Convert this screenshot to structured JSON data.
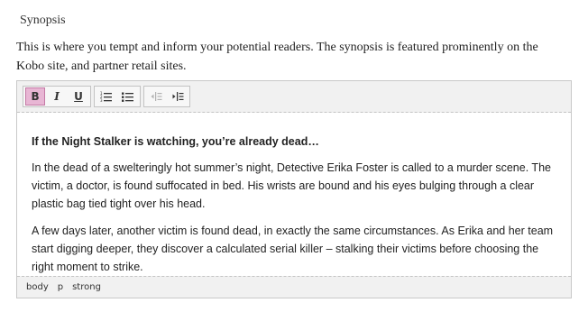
{
  "section": {
    "label": "Synopsis",
    "intro": "This is where you tempt and inform your potential readers. The synopsis is featured prominently on the Kobo site, and partner retail sites."
  },
  "toolbar": {
    "bold_label": "B",
    "italic_label": "I",
    "underline_label": "U",
    "buttons": [
      {
        "name": "bold",
        "icon": "bold-icon",
        "active": true
      },
      {
        "name": "italic",
        "icon": "italic-icon",
        "active": false
      },
      {
        "name": "underline",
        "icon": "underline-icon",
        "active": false
      },
      {
        "name": "numbered-list",
        "icon": "numbered-list-icon"
      },
      {
        "name": "bullet-list",
        "icon": "bullet-list-icon"
      },
      {
        "name": "outdent",
        "icon": "outdent-icon",
        "disabled": true
      },
      {
        "name": "indent",
        "icon": "indent-icon"
      }
    ],
    "active_color": "#e8b6d4"
  },
  "content": {
    "headline": "If the Night Stalker is watching, you’re already dead…",
    "paragraph1": "In the dead of a swelteringly hot summer’s night, Detective Erika Foster is called to a murder scene. The victim, a doctor, is found suffocated in bed. His wrists are bound and his eyes bulging through a clear plastic bag tied tight over his head.",
    "paragraph2": "A few days later, another victim is found dead, in exactly the same circumstances. As Erika and her team start digging deeper, they discover a calculated serial killer – stalking their victims before choosing the right moment to strike."
  },
  "statusbar": {
    "path": [
      "body",
      "p",
      "strong"
    ]
  }
}
